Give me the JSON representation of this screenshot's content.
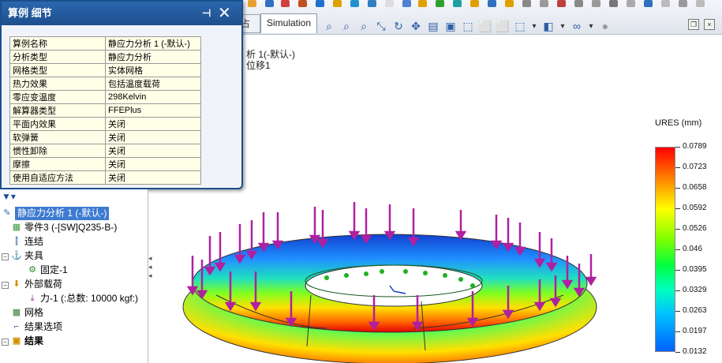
{
  "popup": {
    "title": "算例 细节",
    "pin_icon": "pin-icon",
    "close_icon": "close-icon",
    "rows": [
      {
        "key": "算例名称",
        "value": "静应力分析 1 (-默认-)"
      },
      {
        "key": "分析类型",
        "value": "静应力分析"
      },
      {
        "key": "网格类型",
        "value": "实体网格"
      },
      {
        "key": "热力效果",
        "value": "包括温度载荷"
      },
      {
        "key": "零应变温度",
        "value": "298Kelvin"
      },
      {
        "key": "解算器类型",
        "value": "FFEPlus"
      },
      {
        "key": "平面内效果",
        "value": "关闭"
      },
      {
        "key": "软弹簧",
        "value": "关闭"
      },
      {
        "key": "惯性卸除",
        "value": "关闭"
      },
      {
        "key": "摩擦",
        "value": "关闭"
      },
      {
        "key": "使用自适应方法",
        "value": "关闭"
      }
    ]
  },
  "tabs": {
    "hidden_tab": "占",
    "simulation": "Simulation"
  },
  "viewport": {
    "study_label_1": "析 1(-默认-)",
    "study_label_2": "位移1"
  },
  "tree": {
    "items": [
      {
        "label": "静应力分析 1 (-默认-)",
        "icon": "study-icon"
      },
      {
        "label": "零件3 (-[SW]Q235-B-)",
        "icon": "part-icon"
      },
      {
        "label": "连结",
        "icon": "connection-icon"
      },
      {
        "label": "夹具",
        "icon": "fixture-icon"
      },
      {
        "label": "固定-1",
        "icon": "fixed-icon"
      },
      {
        "label": "外部载荷",
        "icon": "load-icon"
      },
      {
        "label": "力-1 (:总数: 10000 kgf:)",
        "icon": "force-icon"
      },
      {
        "label": "网格",
        "icon": "mesh-icon"
      },
      {
        "label": "结果选项",
        "icon": "result-options-icon"
      },
      {
        "label": "结果",
        "icon": "results-icon"
      }
    ]
  },
  "legend": {
    "title": "URES (mm)",
    "values": [
      "0.0789",
      "0.0723",
      "0.0658",
      "0.0592",
      "0.0526",
      "0.046",
      "0.0395",
      "0.0329",
      "0.0263",
      "0.0197",
      "0.0132"
    ]
  }
}
